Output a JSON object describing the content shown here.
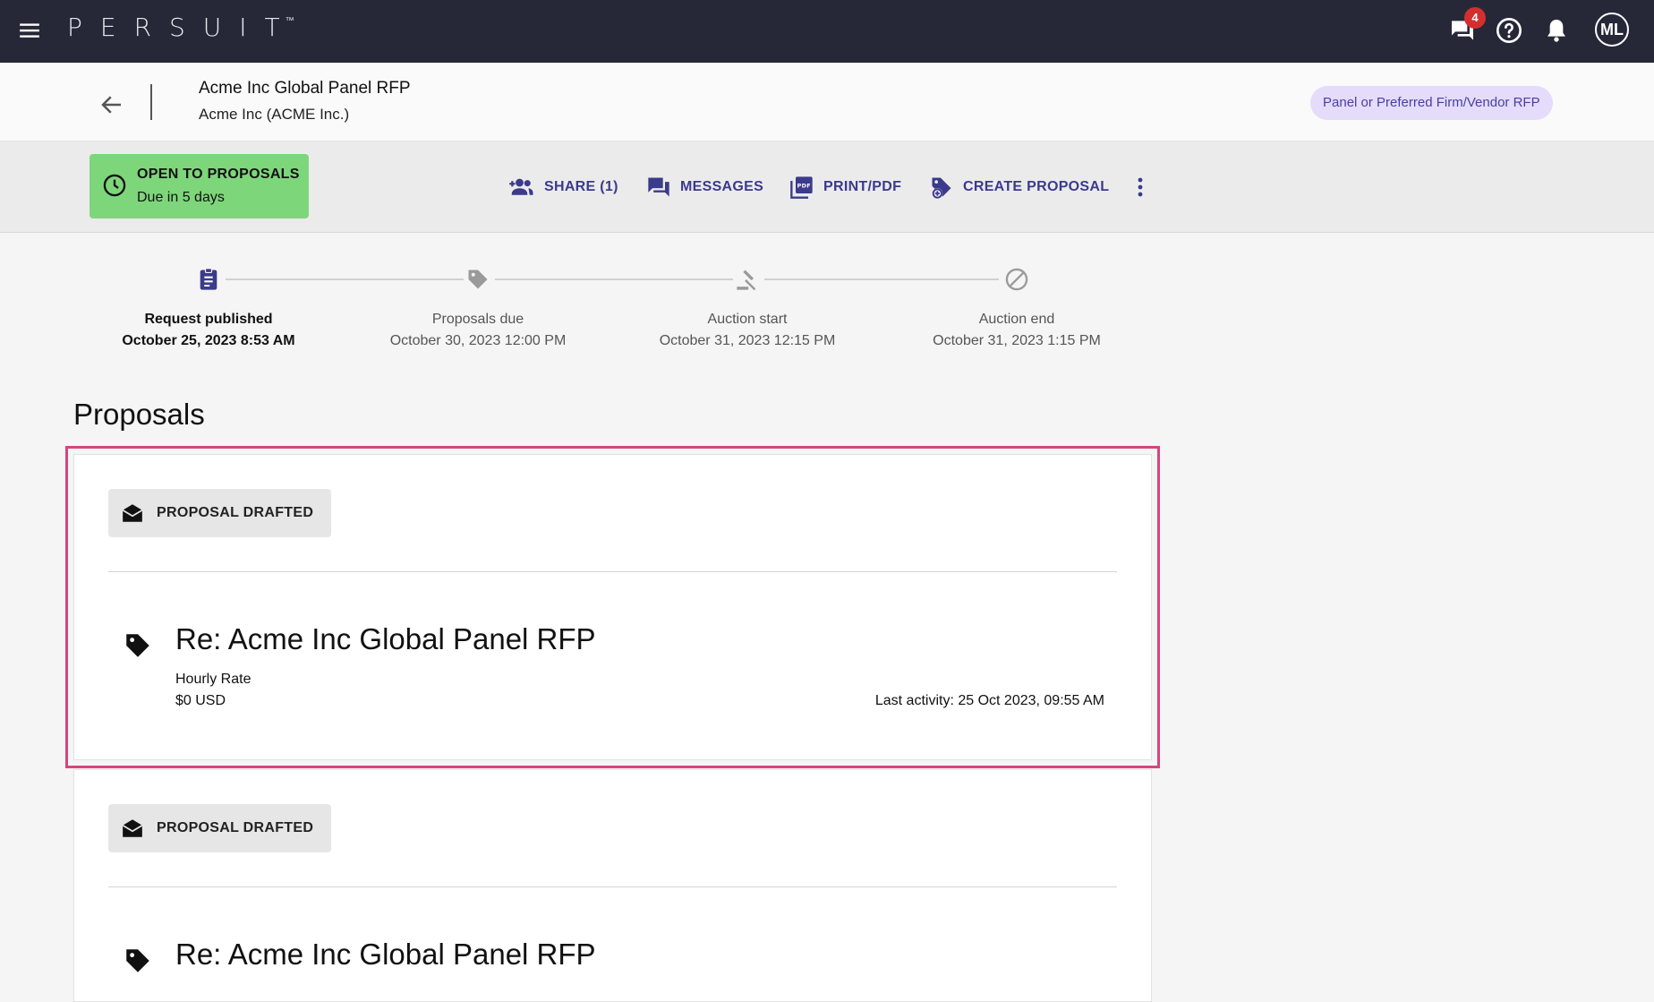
{
  "topbar": {
    "brand": "PERSUIT",
    "trademark": "™",
    "messages_badge": "4",
    "avatar_initials": "ML"
  },
  "header": {
    "title": "Acme Inc Global Panel RFP",
    "subtitle": "Acme Inc (ACME Inc.)",
    "rfp_type": "Panel or Preferred Firm/Vendor RFP"
  },
  "actionbar": {
    "status_label": "OPEN TO PROPOSALS",
    "status_due": "Due in 5 days",
    "status_color": "#7ed67a",
    "actions": {
      "share": "SHARE (1)",
      "messages": "MESSAGES",
      "print": "PRINT/PDF",
      "create": "CREATE PROPOSAL"
    },
    "accent_color": "#3b3a8c"
  },
  "timeline": [
    {
      "label": "Request published",
      "date": "October 25, 2023 8:53 AM",
      "icon": "clipboard-icon",
      "active": true
    },
    {
      "label": "Proposals due",
      "date": "October 30, 2023 12:00 PM",
      "icon": "tag-icon",
      "active": false
    },
    {
      "label": "Auction start",
      "date": "October 31, 2023 12:15 PM",
      "icon": "gavel-icon",
      "active": false
    },
    {
      "label": "Auction end",
      "date": "October 31, 2023 1:15 PM",
      "icon": "blocked-icon",
      "active": false
    }
  ],
  "proposals": {
    "section_title": "Proposals",
    "highlight_color": "#d6457c",
    "items": [
      {
        "status": "PROPOSAL DRAFTED",
        "title": "Re: Acme Inc Global Panel RFP",
        "rate_label": "Hourly Rate",
        "rate_value": "$0 USD",
        "last_activity": "Last activity: 25 Oct 2023, 09:55 AM"
      },
      {
        "status": "PROPOSAL DRAFTED",
        "title": "Re: Acme Inc Global Panel RFP"
      }
    ]
  }
}
